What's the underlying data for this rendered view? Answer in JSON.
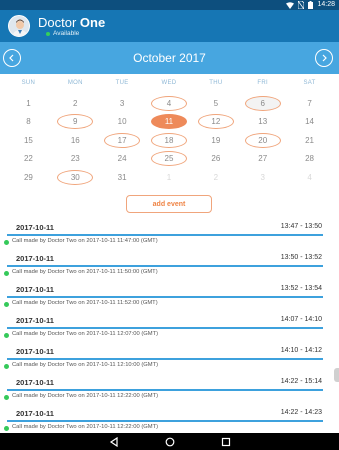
{
  "status_bar": {
    "time": "14:28"
  },
  "header": {
    "user_first_name": "Doctor",
    "user_last_name": "One",
    "status": "Available",
    "status_color": "#35d05a"
  },
  "calendar": {
    "month_title": "October 2017",
    "weekdays": [
      "SUN",
      "MON",
      "TUE",
      "WED",
      "THU",
      "FRI",
      "SAT"
    ],
    "days": [
      {
        "n": "1",
        "m": "cur"
      },
      {
        "n": "2",
        "m": "cur"
      },
      {
        "n": "3",
        "m": "cur"
      },
      {
        "n": "4",
        "m": "event"
      },
      {
        "n": "5",
        "m": "cur"
      },
      {
        "n": "6",
        "m": "event-gray"
      },
      {
        "n": "7",
        "m": "cur"
      },
      {
        "n": "8",
        "m": "cur"
      },
      {
        "n": "9",
        "m": "event"
      },
      {
        "n": "10",
        "m": "cur"
      },
      {
        "n": "11",
        "m": "selected"
      },
      {
        "n": "12",
        "m": "event"
      },
      {
        "n": "13",
        "m": "cur"
      },
      {
        "n": "14",
        "m": "cur"
      },
      {
        "n": "15",
        "m": "cur"
      },
      {
        "n": "16",
        "m": "cur"
      },
      {
        "n": "17",
        "m": "event"
      },
      {
        "n": "18",
        "m": "event"
      },
      {
        "n": "19",
        "m": "cur"
      },
      {
        "n": "20",
        "m": "event"
      },
      {
        "n": "21",
        "m": "cur"
      },
      {
        "n": "22",
        "m": "cur"
      },
      {
        "n": "23",
        "m": "cur"
      },
      {
        "n": "24",
        "m": "cur"
      },
      {
        "n": "25",
        "m": "event"
      },
      {
        "n": "26",
        "m": "cur"
      },
      {
        "n": "27",
        "m": "cur"
      },
      {
        "n": "28",
        "m": "cur"
      },
      {
        "n": "29",
        "m": "cur"
      },
      {
        "n": "30",
        "m": "event"
      },
      {
        "n": "31",
        "m": "cur"
      },
      {
        "n": "1",
        "m": "other"
      },
      {
        "n": "2",
        "m": "other"
      },
      {
        "n": "3",
        "m": "other"
      },
      {
        "n": "4",
        "m": "other"
      }
    ]
  },
  "add_event_label": "add event",
  "events": [
    {
      "date": "2017-10-11",
      "time": "13:47 - 13:50",
      "description": "Call made by Doctor Two on 2017-10-11 11:47:00 (GMT)"
    },
    {
      "date": "2017-10-11",
      "time": "13:50 - 13:52",
      "description": "Call made by Doctor Two on 2017-10-11 11:50:00 (GMT)"
    },
    {
      "date": "2017-10-11",
      "time": "13:52 - 13:54",
      "description": "Call made by Doctor Two on 2017-10-11 11:52:00 (GMT)"
    },
    {
      "date": "2017-10-11",
      "time": "14:07 - 14:10",
      "description": "Call made by Doctor Two on 2017-10-11 12:07:00 (GMT)"
    },
    {
      "date": "2017-10-11",
      "time": "14:10 - 14:12",
      "description": "Call made by Doctor Two on 2017-10-11 12:10:00 (GMT)"
    },
    {
      "date": "2017-10-11",
      "time": "14:22 - 15:14",
      "description": "Call made by Doctor Two on 2017-10-11 12:22:00 (GMT)"
    },
    {
      "date": "2017-10-11",
      "time": "14:22 - 14:23",
      "description": "Call made by Doctor Two on 2017-10-11 12:22:00 (GMT)"
    }
  ],
  "colors": {
    "header_blue": "#1676b4",
    "calendar_blue": "#47a6e0",
    "accent_orange": "#ee8a5a",
    "line_blue": "#3da1dd",
    "online_green": "#35c95a"
  }
}
